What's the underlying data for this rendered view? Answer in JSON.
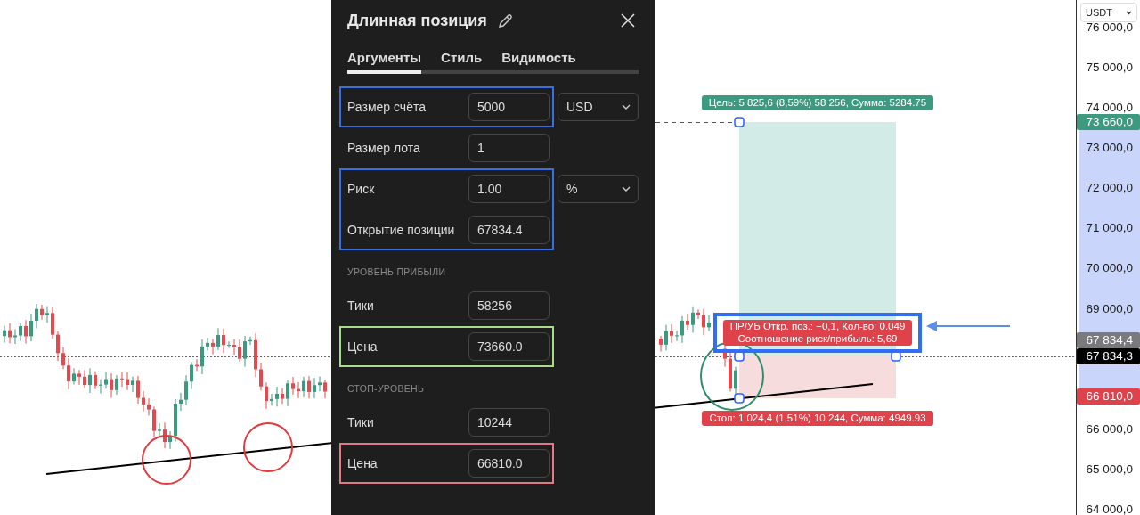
{
  "dialog": {
    "title": "Длинная позиция",
    "tabs": [
      {
        "label": "Аргументы",
        "selected": true
      },
      {
        "label": "Стиль",
        "selected": false
      },
      {
        "label": "Видимость",
        "selected": false
      }
    ],
    "blocks": [
      {
        "kind": "group",
        "color": "#3b6fe0",
        "fields": [
          {
            "label": "Размер счёта",
            "value": "5000",
            "unit": "USD"
          }
        ]
      },
      {
        "kind": "group",
        "fields": [
          {
            "label": "Размер лота",
            "value": "1"
          }
        ]
      },
      {
        "kind": "group",
        "color": "#3b6fe0",
        "fields": [
          {
            "label": "Риск",
            "value": "1.00",
            "unit": "%"
          },
          {
            "label": "Открытие позиции",
            "value": "67834.4"
          }
        ]
      },
      {
        "kind": "heading",
        "text": "УРОВЕНЬ ПРИБЫЛИ"
      },
      {
        "kind": "group",
        "fields": [
          {
            "label": "Тики",
            "value": "58256"
          }
        ]
      },
      {
        "kind": "group",
        "color": "#a8dc8c",
        "fields": [
          {
            "label": "Цена",
            "value": "73660.0"
          }
        ]
      },
      {
        "kind": "heading",
        "text": "СТОП-УРОВЕНЬ"
      },
      {
        "kind": "group",
        "fields": [
          {
            "label": "Тики",
            "value": "10244"
          }
        ]
      },
      {
        "kind": "group",
        "color": "#e07a85",
        "fields": [
          {
            "label": "Цена",
            "value": "66810.0"
          }
        ]
      }
    ]
  },
  "chart": {
    "currency": "USDT",
    "axis_labels": [
      "76 000,0",
      "75 000,0",
      "74 000,0",
      "73 000,0",
      "72 000,0",
      "71 000,0",
      "70 000,0",
      "69 000,0",
      "66 000,0",
      "65 000,0",
      "64 000,0"
    ],
    "price_tags": [
      {
        "text": "73 660,0",
        "color": "#3d9a80"
      },
      {
        "text": "67 834,4",
        "color": "#7a7a7e"
      },
      {
        "text": "67 834,3",
        "color": "#000000"
      },
      {
        "text": "66 810,0",
        "color": "#e0424b"
      }
    ],
    "target_label": "Цель: 5 825,6 (8,59%) 58 256, Сумма: 5284.75",
    "stop_label": "Стоп: 1 024,4 (1,51%) 10 244, Сумма: 4949.93",
    "info_lines": [
      "ПР/УБ Откр. поз.: −0,1, Кол-во: 0.049",
      "Соотношение риск/прибыль: 5,69"
    ]
  }
}
